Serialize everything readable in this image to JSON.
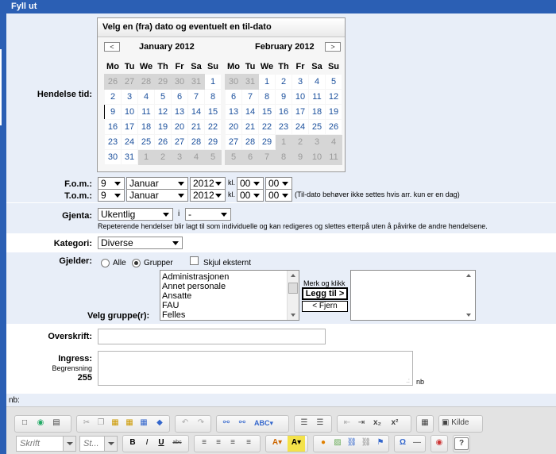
{
  "title": "Fyll ut",
  "labels": {
    "hendelse_tid": "Hendelse tid:",
    "fom": "F.o.m.:",
    "tom": "T.o.m.:",
    "gjenta": "Gjenta:",
    "kategori": "Kategori:",
    "gjelder": "Gjelder:",
    "velg_grupper": "Velg gruppe(r):",
    "overskrift": "Overskrift:",
    "ingress": "Ingress:",
    "begrensning": "Begrensning",
    "limit": "255",
    "nb_suffix": "nb",
    "nb_label": "nb:",
    "kl": "kl."
  },
  "calendar": {
    "header": "Velg en (fra) dato og eventuelt en til-dato",
    "prev": "<",
    "next": ">",
    "weekdays": [
      "Mo",
      "Tu",
      "We",
      "Th",
      "Fr",
      "Sa",
      "Su"
    ],
    "left": {
      "title": "January 2012",
      "weeks": [
        [
          "26",
          "27",
          "28",
          "29",
          "30",
          "31",
          "1"
        ],
        [
          "2",
          "3",
          "4",
          "5",
          "6",
          "7",
          "8"
        ],
        [
          "9",
          "10",
          "11",
          "12",
          "13",
          "14",
          "15"
        ],
        [
          "16",
          "17",
          "18",
          "19",
          "20",
          "21",
          "22"
        ],
        [
          "23",
          "24",
          "25",
          "26",
          "27",
          "28",
          "29"
        ],
        [
          "30",
          "31",
          "1",
          "2",
          "3",
          "4",
          "5"
        ]
      ],
      "out": [
        [
          1,
          1,
          1,
          1,
          1,
          1,
          0
        ],
        [
          0,
          0,
          0,
          0,
          0,
          0,
          0
        ],
        [
          0,
          0,
          0,
          0,
          0,
          0,
          0
        ],
        [
          0,
          0,
          0,
          0,
          0,
          0,
          0
        ],
        [
          0,
          0,
          0,
          0,
          0,
          0,
          0
        ],
        [
          0,
          0,
          1,
          1,
          1,
          1,
          1
        ]
      ],
      "today": [
        2,
        0
      ]
    },
    "right": {
      "title": "February 2012",
      "weeks": [
        [
          "30",
          "31",
          "1",
          "2",
          "3",
          "4",
          "5"
        ],
        [
          "6",
          "7",
          "8",
          "9",
          "10",
          "11",
          "12"
        ],
        [
          "13",
          "14",
          "15",
          "16",
          "17",
          "18",
          "19"
        ],
        [
          "20",
          "21",
          "22",
          "23",
          "24",
          "25",
          "26"
        ],
        [
          "27",
          "28",
          "29",
          "1",
          "2",
          "3",
          "4"
        ],
        [
          "5",
          "6",
          "7",
          "8",
          "9",
          "10",
          "11"
        ]
      ],
      "out": [
        [
          1,
          1,
          0,
          0,
          0,
          0,
          0
        ],
        [
          0,
          0,
          0,
          0,
          0,
          0,
          0
        ],
        [
          0,
          0,
          0,
          0,
          0,
          0,
          0
        ],
        [
          0,
          0,
          0,
          0,
          0,
          0,
          0
        ],
        [
          0,
          0,
          0,
          1,
          1,
          1,
          1
        ],
        [
          1,
          1,
          1,
          1,
          1,
          1,
          1
        ]
      ]
    }
  },
  "fom": {
    "day": "9",
    "month": "Januar",
    "year": "2012",
    "hour": "00",
    "minute": "00"
  },
  "tom": {
    "day": "9",
    "month": "Januar",
    "year": "2012",
    "hour": "00",
    "minute": "00",
    "note": "(Til-dato behøver ikke settes hvis arr. kun er en dag)"
  },
  "gjenta": {
    "value": "Ukentlig",
    "i": "i",
    "interval": "-",
    "note": "Repeterende hendelser blir lagt til som individuelle og kan redigeres og slettes etterpå uten å påvirke de andre hendelsene."
  },
  "kategori": {
    "value": "Diverse"
  },
  "gjelder": {
    "options": [
      "Alle",
      "Grupper"
    ],
    "hide": "Skjul eksternt",
    "groups": [
      "Administrasjonen",
      "Annet personale",
      "Ansatte",
      "FAU",
      "Felles"
    ],
    "merk": "Merk og klikk",
    "add": "Legg til >",
    "remove": "< Fjern"
  },
  "toolbar": {
    "font": "Skrift",
    "size": "St...",
    "source": "Kilde",
    "bold": "B",
    "italic": "I",
    "underline": "U",
    "strike": "abc",
    "sub": "x₂",
    "sup": "x²",
    "omega": "Ω",
    "help": "?",
    "icons": [
      "new-page-icon",
      "preview-icon",
      "print-icon",
      "cut-icon",
      "copy-icon",
      "paste-icon",
      "paste-text-icon",
      "paste-word-icon",
      "eraser-icon",
      "undo-icon",
      "redo-icon",
      "find-icon",
      "replace-icon",
      "spellcheck-icon",
      "numbered-list-icon",
      "bullet-list-icon",
      "outdent-icon",
      "indent-icon",
      "table-icon",
      "source-icon",
      "align-left-icon",
      "align-center-icon",
      "align-right-icon",
      "justify-icon",
      "text-color-icon",
      "bg-color-icon",
      "smiley-icon",
      "image-icon",
      "link-icon",
      "unlink-icon",
      "anchor-icon",
      "special-char-icon",
      "hr-icon",
      "flash-icon"
    ]
  }
}
